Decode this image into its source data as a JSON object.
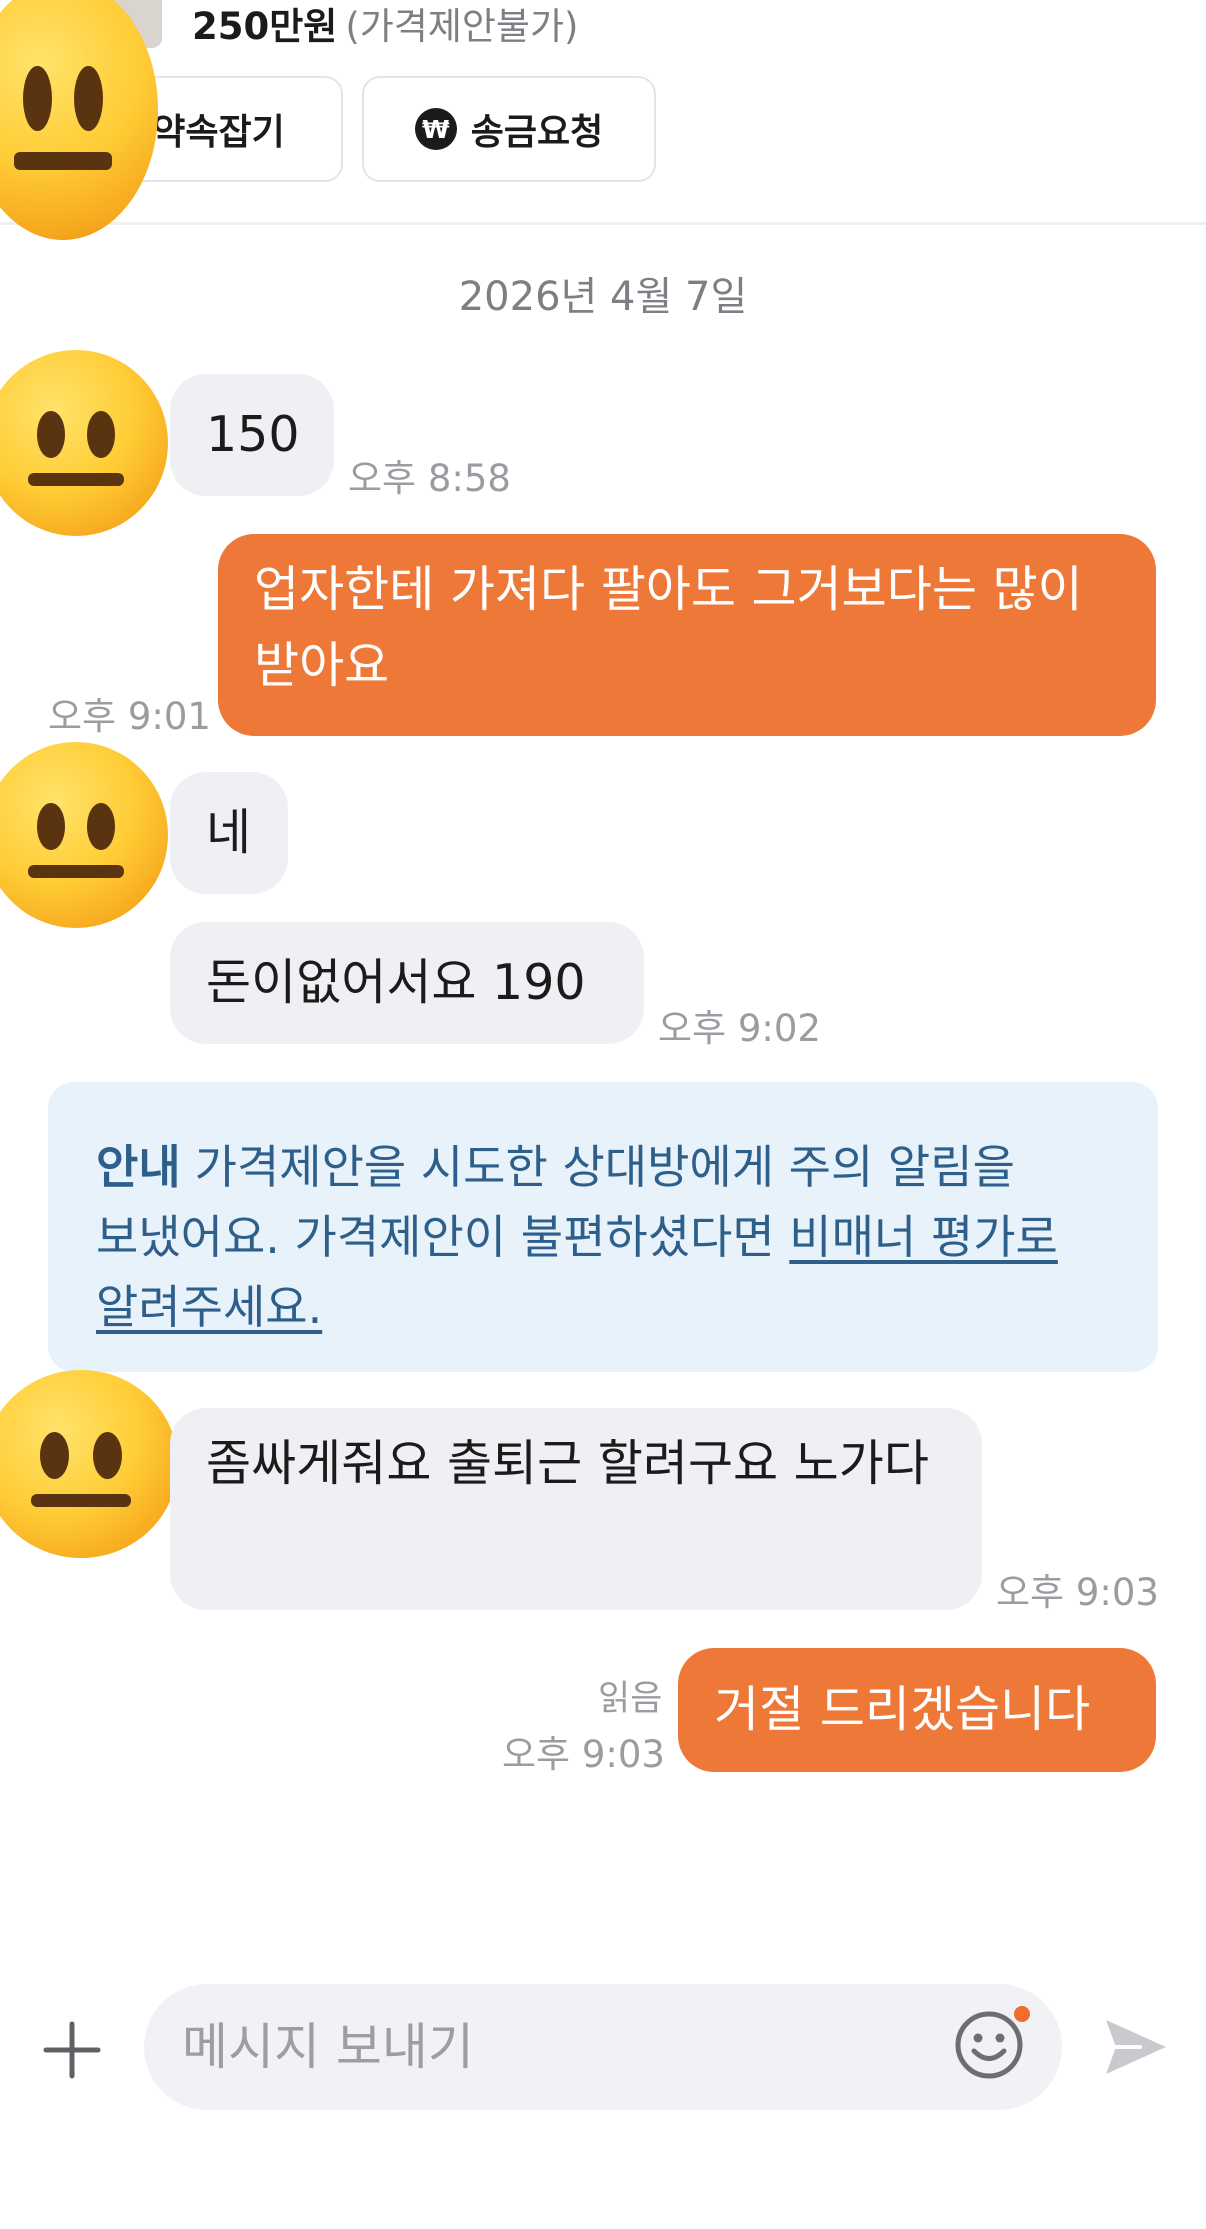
{
  "product": {
    "price": "250만원",
    "price_note": "(가격제안불가)"
  },
  "actions": {
    "appointment_label": "약속잡기",
    "remit_label": "송금요청",
    "remit_icon_glyph": "₩"
  },
  "chat": {
    "date": "2026년 4월 7일",
    "messages": [
      {
        "side": "in",
        "text": "150",
        "time": "오후 8:58"
      },
      {
        "side": "out",
        "text": "업자한테 가져다 팔아도 그거보다는 많이 받아요",
        "time": "오후 9:01"
      },
      {
        "side": "in",
        "text": "네",
        "time": ""
      },
      {
        "side": "in",
        "text": "돈이없어서요 190",
        "time": "오후 9:02"
      },
      {
        "side": "in",
        "text": "좀싸게줘요 출퇴근 할려구요 노가다",
        "time": "오후 9:03"
      },
      {
        "side": "out",
        "text": "거절 드리겠습니다",
        "time": "오후 9:03",
        "read": "읽음"
      }
    ]
  },
  "notice": {
    "label": "안내",
    "text": "가격제안을 시도한 상대방에게 주의 알림을 보냈어요. 가격제안이 불편하셨다면 ",
    "link": "비매너 평가로 알려주세요."
  },
  "input": {
    "placeholder": "메시지 보내기",
    "value": ""
  },
  "icons": {
    "avatar": "neutral-face-emoji",
    "attach": "plus-icon",
    "emoji": "smile-icon",
    "send": "send-icon"
  },
  "colors": {
    "accent": "#ee7838",
    "incoming_bubble": "#eff0f4",
    "notice_bg": "#e8f2fb",
    "notice_text": "#2e5f8a",
    "timestamp": "#9a9ca1"
  }
}
